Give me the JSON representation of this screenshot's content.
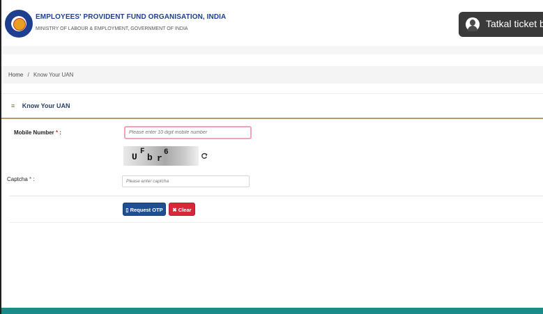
{
  "header": {
    "org_name": "EMPLOYEES' PROVIDENT FUND ORGANISATION, INDIA",
    "ministry": "MINISTRY OF LABOUR & EMPLOYMENT, GOVERNMENT OF INDIA",
    "popup_label": "Tatkal ticket b"
  },
  "breadcrumb": {
    "home": "Home",
    "separator": "/",
    "current": "Know Your UAN"
  },
  "card": {
    "title": "Know Your UAN",
    "menu_glyph": "≡"
  },
  "form": {
    "mobile_label": "Mobile Number",
    "mobile_placeholder": "Please enter 10 digit mobile number",
    "captcha_label": "Captcha",
    "captcha_placeholder": "Please enter captcha",
    "required_mark": "*",
    "colon": ":",
    "captcha_chars": [
      "U",
      "F",
      "b",
      "r",
      "6"
    ],
    "request_otp_label": "Request OTP",
    "clear_label": "Clear"
  },
  "colors": {
    "brand_blue": "#1e3f8f",
    "otp_button": "#1f4e93",
    "clear_button": "#d9273a",
    "accent_line": "#b79a63",
    "footer_teal": "#1f8a8a",
    "required_red": "#d32f2f"
  },
  "icons": [
    "epfo-logo-icon",
    "avatar-icon",
    "menu-icon",
    "refresh-icon",
    "send-icon",
    "close-icon"
  ]
}
